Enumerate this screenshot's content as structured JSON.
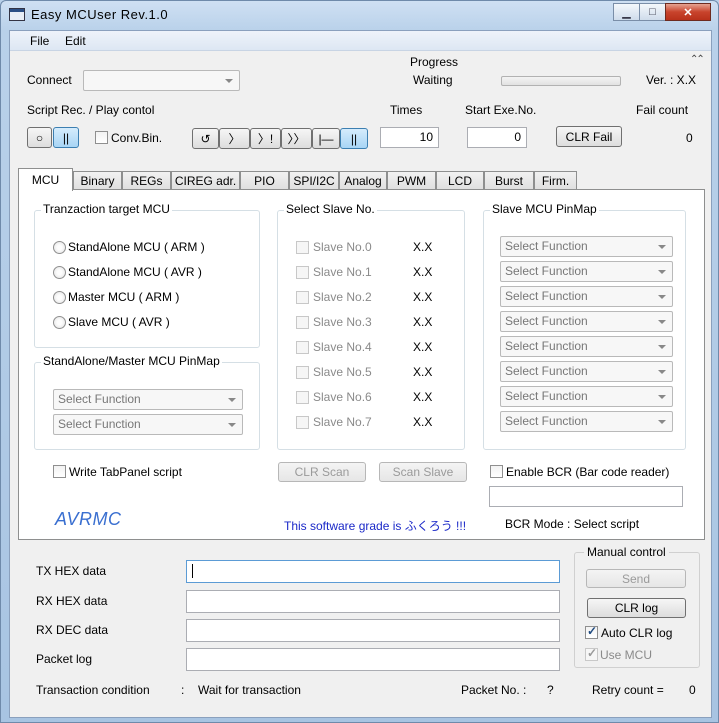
{
  "window": {
    "title": "Easy MCUser Rev.1.0",
    "minimize_glyph": "▁",
    "maximize_glyph": "□",
    "close_glyph": "✕"
  },
  "menu": [
    "File",
    "Edit"
  ],
  "header": {
    "connect_label": "Connect",
    "connect_value": "",
    "progress_label": "Progress",
    "progress_status": "Waiting",
    "progress_fraction": 0,
    "collapse_glyph": "⌃⌃",
    "version": "Ver. : X.X"
  },
  "script": {
    "label": "Script Rec. / Play contol",
    "rec_glyph": "○",
    "pause_glyph": "||",
    "conv_bin_label": "Conv.Bin.",
    "play_buttons": [
      "↺",
      "〉",
      "〉!",
      "〉〉",
      "|—",
      "||"
    ],
    "times_label": "Times",
    "times_value": "10",
    "start_label": "Start Exe.No.",
    "start_value": "0",
    "clr_fail_label": "CLR Fail",
    "fail_count_label": "Fail count",
    "fail_count_value": "0"
  },
  "tabs": [
    "MCU",
    "Binary",
    "REGs",
    "CIREG adr.",
    "PIO",
    "SPI/I2C",
    "Analog",
    "PWM",
    "LCD",
    "Burst",
    "Firm."
  ],
  "mcu_tab": {
    "target_title": "Tranzaction target MCU",
    "target_options": [
      "StandAlone MCU ( ARM )",
      "StandAlone MCU ( AVR )",
      "Master MCU ( ARM )",
      "Slave MCU ( AVR )"
    ],
    "pinmap_title": "StandAlone/Master MCU PinMap",
    "pinmap_selects": [
      "Select Function",
      "Select Function"
    ],
    "slave_title": "Select Slave No.",
    "slaves": [
      {
        "label": "Slave No.0",
        "value": "X.X"
      },
      {
        "label": "Slave No.1",
        "value": "X.X"
      },
      {
        "label": "Slave No.2",
        "value": "X.X"
      },
      {
        "label": "Slave No.3",
        "value": "X.X"
      },
      {
        "label": "Slave No.4",
        "value": "X.X"
      },
      {
        "label": "Slave No.5",
        "value": "X.X"
      },
      {
        "label": "Slave No.6",
        "value": "X.X"
      },
      {
        "label": "Slave No.7",
        "value": "X.X"
      }
    ],
    "slave_pinmap_title": "Slave MCU PinMap",
    "slave_pinmap_selects": [
      "Select Function",
      "Select Function",
      "Select Function",
      "Select Function",
      "Select Function",
      "Select Function",
      "Select Function",
      "Select Function"
    ],
    "write_tab_script_label": "Write TabPanel script",
    "clr_scan_label": "CLR Scan",
    "scan_slave_label": "Scan Slave",
    "enable_bcr_label": "Enable BCR (Bar code reader)",
    "bcr_input_value": "",
    "logo_text": "AVRMC",
    "grade_text": "This software grade is ふくろう !!!",
    "bcr_mode_text": "BCR Mode : Select script",
    "logo_color": "#3a6fd0",
    "grade_color": "#1a28c8"
  },
  "bottom": {
    "tx_label": "TX HEX data",
    "tx_value": "",
    "rx_hex_label": "RX HEX data",
    "rx_hex_value": "",
    "rx_dec_label": "RX DEC data",
    "rx_dec_value": "",
    "packet_log_label": "Packet log",
    "packet_log_value": "",
    "manual_title": "Manual control",
    "send_label": "Send",
    "clr_log_label": "CLR log",
    "auto_clr_label": "Auto CLR log",
    "use_mcu_label": "Use MCU",
    "transaction_label": "Transaction condition",
    "colon": ":",
    "transaction_value": "Wait for transaction",
    "packet_no_label": "Packet No. :",
    "packet_no_value": "?",
    "retry_label": "Retry count  =",
    "retry_value": "0"
  }
}
